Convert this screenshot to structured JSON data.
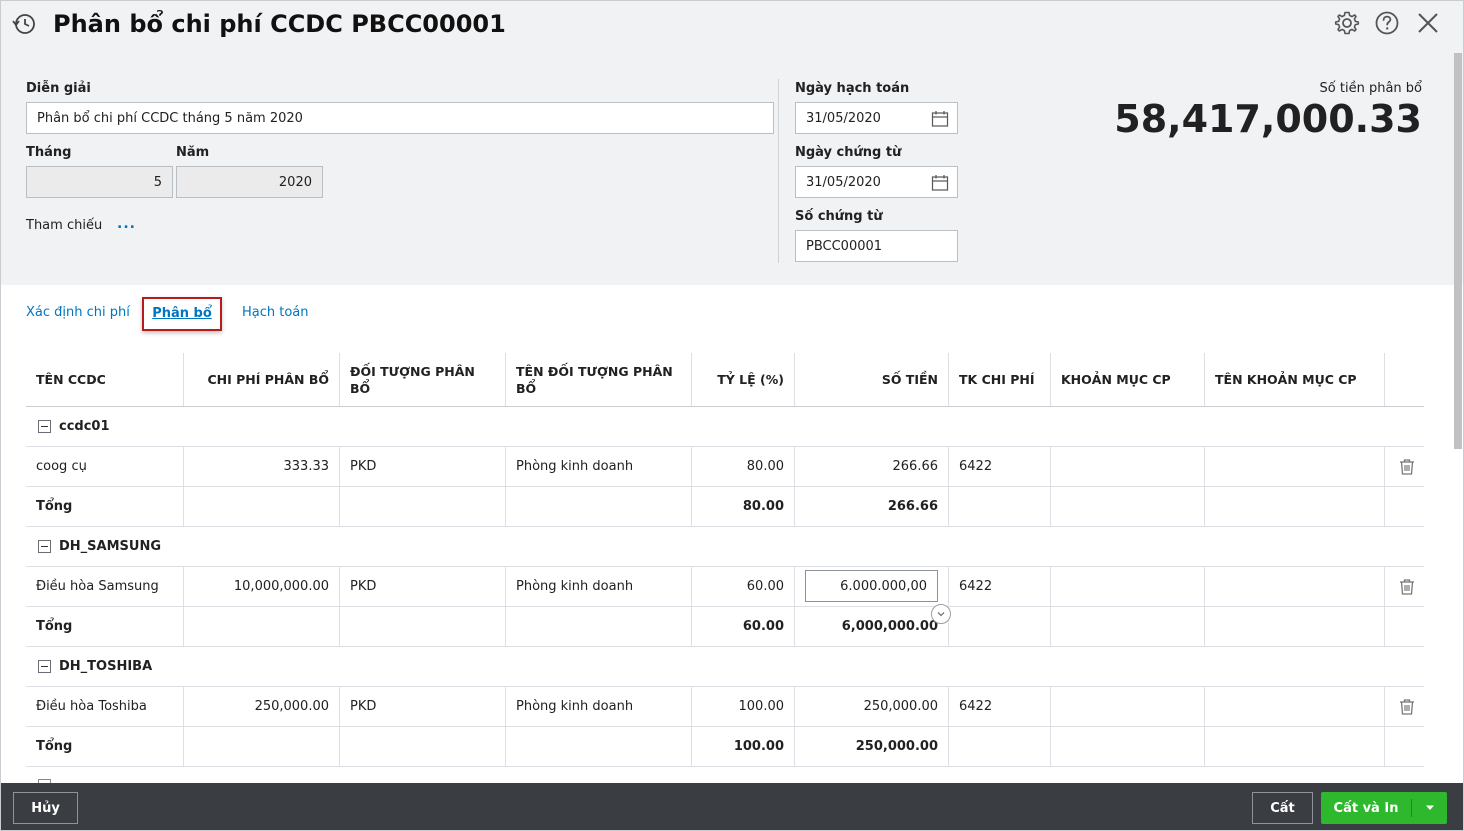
{
  "header": {
    "title": "Phân bổ chi phí CCDC PBCC00001"
  },
  "form": {
    "description_label": "Diễn giải",
    "description_value": "Phân bổ chi phí CCDC tháng 5 năm 2020",
    "month_label": "Tháng",
    "month_value": "5",
    "year_label": "Năm",
    "year_value": "2020",
    "reference_label": "Tham chiếu",
    "reference_more": "...",
    "posting_date_label": "Ngày hạch toán",
    "posting_date_value": "31/05/2020",
    "voucher_date_label": "Ngày chứng từ",
    "voucher_date_value": "31/05/2020",
    "voucher_no_label": "Số chứng từ",
    "voucher_no_value": "PBCC00001",
    "amount_label": "Số tiền phân bổ",
    "amount_value": "58,417,000.33"
  },
  "tabs": [
    {
      "label": "Xác định chi phí"
    },
    {
      "label": "Phân bổ"
    },
    {
      "label": "Hạch toán"
    }
  ],
  "table": {
    "columns": [
      "TÊN CCDC",
      "CHI PHÍ PHÂN BỔ",
      "ĐỐI TƯỢNG PHÂN BỔ",
      "TÊN ĐỐI TƯỢNG PHÂN BỔ",
      "TỶ LỆ (%)",
      "SỐ TIỀN",
      "TK CHI PHÍ",
      "KHOẢN MỤC CP",
      "TÊN KHOẢN MỤC CP"
    ],
    "groups": [
      {
        "name": "ccdc01",
        "item": {
          "name": "coog cụ",
          "cost": "333.33",
          "object": "PKD",
          "object_name": "Phòng kinh doanh",
          "rate": "80.00",
          "amount": "266.66",
          "account": "6422"
        },
        "total": {
          "label": "Tổng",
          "rate": "80.00",
          "amount": "266.66"
        }
      },
      {
        "name": "DH_SAMSUNG",
        "item": {
          "name": "Điều hòa Samsung",
          "cost": "10,000,000.00",
          "object": "PKD",
          "object_name": "Phòng kinh doanh",
          "rate": "60.00",
          "amount": "6.000.000,00",
          "account": "6422"
        },
        "total": {
          "label": "Tổng",
          "rate": "60.00",
          "amount": "6,000,000.00"
        }
      },
      {
        "name": "DH_TOSHIBA",
        "item": {
          "name": "Điều hòa Toshiba",
          "cost": "250,000.00",
          "object": "PKD",
          "object_name": "Phòng kinh doanh",
          "rate": "100.00",
          "amount": "250,000.00",
          "account": "6422"
        },
        "total": {
          "label": "Tổng",
          "rate": "100.00",
          "amount": "250,000.00"
        }
      }
    ]
  },
  "footer": {
    "cancel_label": "Hủy",
    "save_label": "Cất",
    "save_print_label": "Cất và In"
  }
}
